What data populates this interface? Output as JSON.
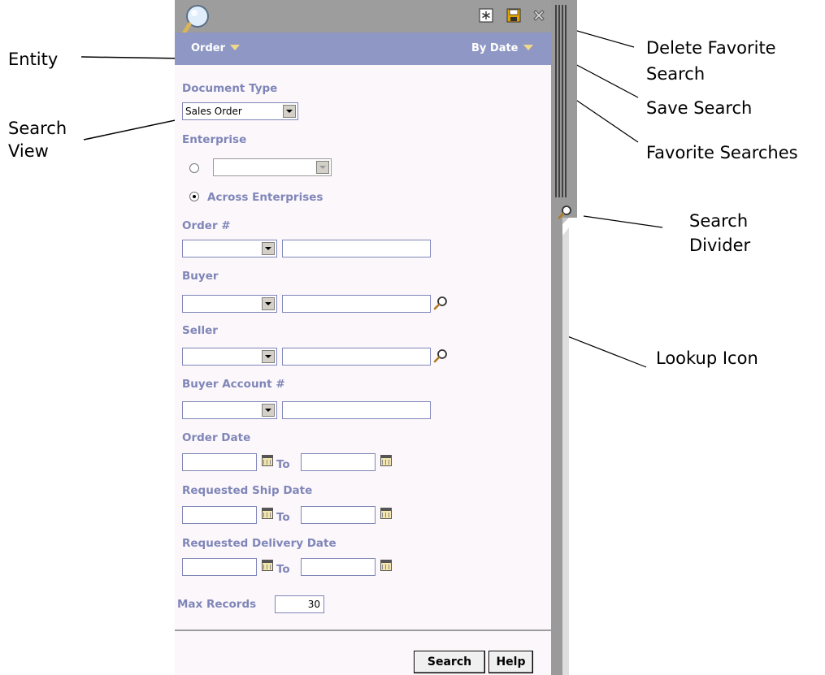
{
  "callouts": {
    "entity": "Entity",
    "search_view_1": "Search",
    "search_view_2": "View",
    "delete_favorite_1": "Delete Favorite",
    "delete_favorite_2": "Search",
    "save_search": "Save Search",
    "favorite_searches": "Favorite Searches",
    "search_divider_1": "Search",
    "search_divider_2": "Divider",
    "lookup_icon": "Lookup Icon"
  },
  "header": {
    "entity": "Order",
    "view": "By Date"
  },
  "form": {
    "document_type_label": "Document Type",
    "document_type_value": "Sales Order",
    "enterprise_label": "Enterprise",
    "enterprise_value": "",
    "across_label": "Across Enterprises",
    "order_no_label": "Order #",
    "buyer_label": "Buyer",
    "seller_label": "Seller",
    "buyer_account_label": "Buyer Account #",
    "order_date_label": "Order Date",
    "req_ship_label": "Requested Ship Date",
    "req_delivery_label": "Requested Delivery Date",
    "to_label": "To",
    "max_records_label": "Max Records",
    "max_records_value": "30"
  },
  "buttons": {
    "search": "Search",
    "help": "Help"
  },
  "icons": {
    "toolbar": [
      "favorite-searches-icon",
      "save-search-icon",
      "delete-favorite-icon"
    ],
    "lookup": "magnifier-icon",
    "calendar": "calendar-icon"
  },
  "colors": {
    "header": "#8f98c4",
    "label": "#7f86b8",
    "panel_bg": "#fcf7fb",
    "toolbar": "#9d9d9d"
  }
}
